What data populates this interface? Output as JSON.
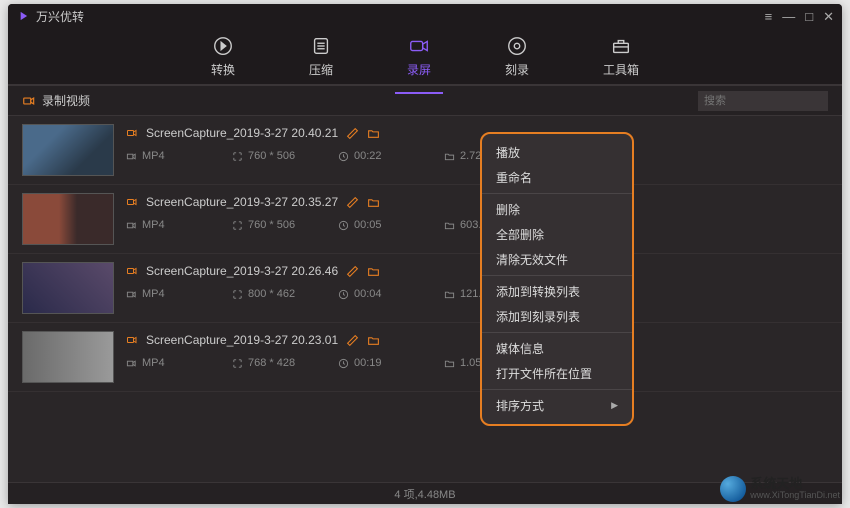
{
  "app": {
    "title": "万兴优转"
  },
  "nav": {
    "items": [
      {
        "label": "转换"
      },
      {
        "label": "压缩"
      },
      {
        "label": "录屏"
      },
      {
        "label": "刻录"
      },
      {
        "label": "工具箱"
      }
    ]
  },
  "subheader": {
    "title": "录制视频",
    "search_placeholder": "搜索"
  },
  "files": [
    {
      "name": "ScreenCapture_2019-3-27 20.40.21",
      "format": "MP4",
      "resolution": "760 * 506",
      "duration": "00:22",
      "size": "2.72MB"
    },
    {
      "name": "ScreenCapture_2019-3-27 20.35.27",
      "format": "MP4",
      "resolution": "760 * 506",
      "duration": "00:05",
      "size": "603.62KB"
    },
    {
      "name": "ScreenCapture_2019-3-27 20.26.46",
      "format": "MP4",
      "resolution": "800 * 462",
      "duration": "00:04",
      "size": "121.16KB"
    },
    {
      "name": "ScreenCapture_2019-3-27 20.23.01",
      "format": "MP4",
      "resolution": "768 * 428",
      "duration": "00:19",
      "size": "1.05MB"
    }
  ],
  "context_menu": {
    "play": "播放",
    "rename": "重命名",
    "delete": "删除",
    "delete_all": "全部删除",
    "clear_invalid": "清除无效文件",
    "add_to_convert": "添加到转换列表",
    "add_to_burn": "添加到刻录列表",
    "media_info": "媒体信息",
    "open_location": "打开文件所在位置",
    "sort_by": "排序方式"
  },
  "status": {
    "summary": "4 项,4.48MB"
  },
  "watermark": {
    "name": "系统天地",
    "url": "www.XiTongTianDi.net"
  }
}
